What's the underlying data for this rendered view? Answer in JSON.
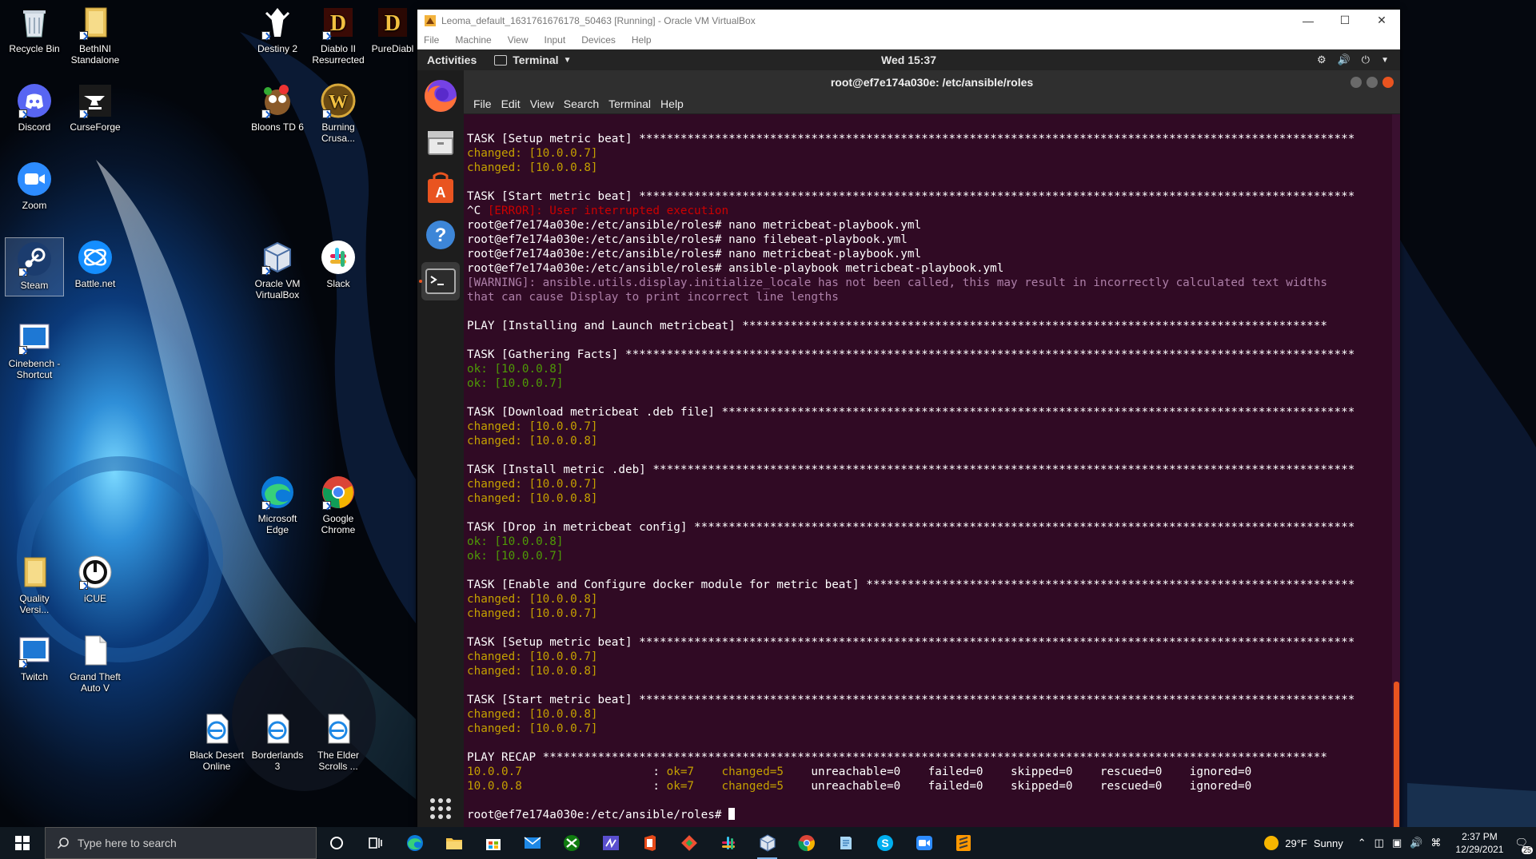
{
  "desktop": {
    "icons": [
      {
        "label": "Recycle Bin"
      },
      {
        "label": "BethINI Standalone"
      },
      {
        "label": "Discord"
      },
      {
        "label": "CurseForge"
      },
      {
        "label": "Zoom"
      },
      {
        "label": "Steam"
      },
      {
        "label": "Battle.net"
      },
      {
        "label": "Cinebench - Shortcut"
      },
      {
        "label": "Quality Versi..."
      },
      {
        "label": "iCUE"
      },
      {
        "label": "Twitch"
      },
      {
        "label": "Grand Theft Auto V"
      },
      {
        "label": "Destiny 2"
      },
      {
        "label": "Diablo II Resurrected"
      },
      {
        "label": "PureDiabl"
      },
      {
        "label": "Bloons TD 6"
      },
      {
        "label": "Burning Crusa..."
      },
      {
        "label": "Oracle VM VirtualBox"
      },
      {
        "label": "Slack"
      },
      {
        "label": "Microsoft Edge"
      },
      {
        "label": "Google Chrome"
      },
      {
        "label": "Black Desert Online"
      },
      {
        "label": "Borderlands 3"
      },
      {
        "label": "The Elder Scrolls ..."
      }
    ]
  },
  "vbox": {
    "title": "Leoma_default_1631761676178_50463 [Running] - Oracle VM VirtualBox",
    "menu": [
      "File",
      "Machine",
      "View",
      "Input",
      "Devices",
      "Help"
    ]
  },
  "gnome": {
    "activities": "Activities",
    "app_menu": "Terminal",
    "clock": "Wed 15:37"
  },
  "terminal": {
    "title": "root@ef7e174a030e: /etc/ansible/roles",
    "menu": [
      "File",
      "Edit",
      "View",
      "Search",
      "Terminal",
      "Help"
    ],
    "prompt": "root@ef7e174a030e:/etc/ansible/roles# ",
    "lines": [
      {
        "t": "",
        "c": "white"
      },
      {
        "t": "TASK [Setup metric beat] ********************************************************************************************************",
        "c": "white"
      },
      {
        "t": "changed: [10.0.0.7]",
        "c": "changed"
      },
      {
        "t": "changed: [10.0.0.8]",
        "c": "changed"
      },
      {
        "t": "",
        "c": "white"
      },
      {
        "t": "TASK [Start metric beat] ********************************************************************************************************",
        "c": "white"
      },
      {
        "t": "^C ",
        "c": "white",
        "rest": "[ERROR]: User interrupted execution",
        "rc": "error"
      },
      {
        "t": "root@ef7e174a030e:/etc/ansible/roles# nano metricbeat-playbook.yml",
        "c": "white"
      },
      {
        "t": "root@ef7e174a030e:/etc/ansible/roles# nano filebeat-playbook.yml",
        "c": "white"
      },
      {
        "t": "root@ef7e174a030e:/etc/ansible/roles# nano metricbeat-playbook.yml",
        "c": "white"
      },
      {
        "t": "root@ef7e174a030e:/etc/ansible/roles# ansible-playbook metricbeat-playbook.yml",
        "c": "white"
      },
      {
        "t": "[WARNING]: ansible.utils.display.initialize_locale has not been called, this may result in incorrectly calculated text widths",
        "c": "warn"
      },
      {
        "t": "that can cause Display to print incorrect line lengths",
        "c": "warn"
      },
      {
        "t": "",
        "c": "white"
      },
      {
        "t": "PLAY [Installing and Launch metricbeat] *************************************************************************************",
        "c": "white"
      },
      {
        "t": "",
        "c": "white"
      },
      {
        "t": "TASK [Gathering Facts] **********************************************************************************************************",
        "c": "white"
      },
      {
        "t": "ok: [10.0.0.8]",
        "c": "ok"
      },
      {
        "t": "ok: [10.0.0.7]",
        "c": "ok"
      },
      {
        "t": "",
        "c": "white"
      },
      {
        "t": "TASK [Download metricbeat .deb file] ********************************************************************************************",
        "c": "white"
      },
      {
        "t": "changed: [10.0.0.7]",
        "c": "changed"
      },
      {
        "t": "changed: [10.0.0.8]",
        "c": "changed"
      },
      {
        "t": "",
        "c": "white"
      },
      {
        "t": "TASK [Install metric .deb] ******************************************************************************************************",
        "c": "white"
      },
      {
        "t": "changed: [10.0.0.7]",
        "c": "changed"
      },
      {
        "t": "changed: [10.0.0.8]",
        "c": "changed"
      },
      {
        "t": "",
        "c": "white"
      },
      {
        "t": "TASK [Drop in metricbeat config] ************************************************************************************************",
        "c": "white"
      },
      {
        "t": "ok: [10.0.0.8]",
        "c": "ok"
      },
      {
        "t": "ok: [10.0.0.7]",
        "c": "ok"
      },
      {
        "t": "",
        "c": "white"
      },
      {
        "t": "TASK [Enable and Configure docker module for metric beat] ***********************************************************************",
        "c": "white"
      },
      {
        "t": "changed: [10.0.0.8]",
        "c": "changed"
      },
      {
        "t": "changed: [10.0.0.7]",
        "c": "changed"
      },
      {
        "t": "",
        "c": "white"
      },
      {
        "t": "TASK [Setup metric beat] ********************************************************************************************************",
        "c": "white"
      },
      {
        "t": "changed: [10.0.0.7]",
        "c": "changed"
      },
      {
        "t": "changed: [10.0.0.8]",
        "c": "changed"
      },
      {
        "t": "",
        "c": "white"
      },
      {
        "t": "TASK [Start metric beat] ********************************************************************************************************",
        "c": "white"
      },
      {
        "t": "changed: [10.0.0.8]",
        "c": "changed"
      },
      {
        "t": "changed: [10.0.0.7]",
        "c": "changed"
      },
      {
        "t": "",
        "c": "white"
      },
      {
        "t": "PLAY RECAP ******************************************************************************************************************",
        "c": "white"
      }
    ],
    "recap": [
      {
        "host": "10.0.0.7",
        "ok": "ok=7",
        "changed": "changed=5",
        "unreachable": "unreachable=0",
        "failed": "failed=0",
        "skipped": "skipped=0",
        "rescued": "rescued=0",
        "ignored": "ignored=0"
      },
      {
        "host": "10.0.0.8",
        "ok": "ok=7",
        "changed": "changed=5",
        "unreachable": "unreachable=0",
        "failed": "failed=0",
        "skipped": "skipped=0",
        "rescued": "rescued=0",
        "ignored": "ignored=0"
      }
    ],
    "final_prompt": "root@ef7e174a030e:/etc/ansible/roles# "
  },
  "taskbar": {
    "search_placeholder": "Type here to search",
    "weather_temp": "29°F",
    "weather_cond": "Sunny",
    "time": "2:37 PM",
    "date": "12/29/2021",
    "notification_count": "25"
  },
  "colors": {
    "terminal_bg": "#300a24",
    "ubuntu_orange": "#e95420",
    "ansible_changed": "#c4a000",
    "ansible_ok": "#4e9a06",
    "ansible_error": "#cc0000",
    "ansible_warning": "#ad7fa8"
  }
}
